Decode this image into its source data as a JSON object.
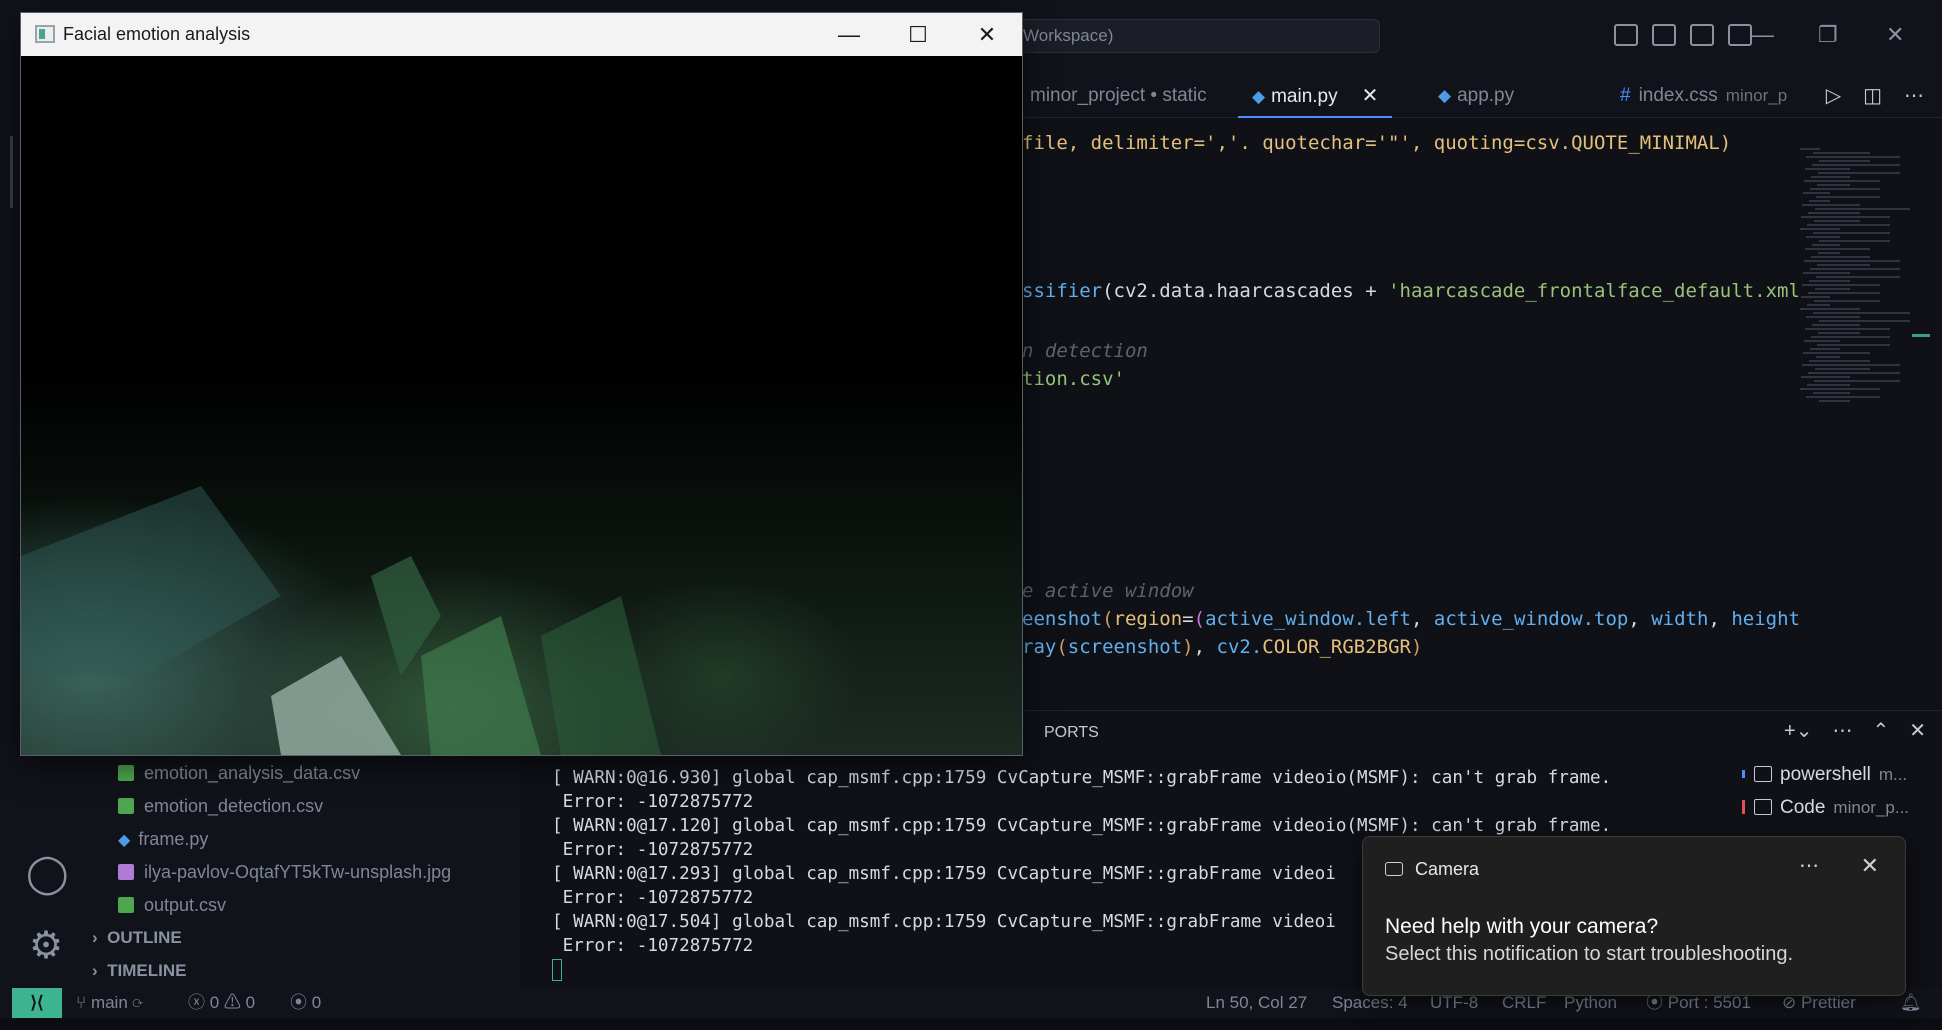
{
  "titlebar": {
    "command_center": "Workspace)"
  },
  "tabs": [
    {
      "label": "minor_project • static",
      "active": false
    },
    {
      "label": "main.py",
      "active": true
    },
    {
      "label": "app.py",
      "active": false
    },
    {
      "label": "index.css",
      "sub": "minor_p",
      "active": false
    }
  ],
  "editor": {
    "lines": [
      {
        "parts": [
          [
            "c-y",
            "file, delimiter=','. quotechar='\"', quoting=csv.QUOTE_MINIMAL)"
          ]
        ]
      },
      {
        "parts": [
          [
            "c-b",
            "ssifier"
          ],
          [
            "c-w",
            "("
          ],
          [
            "c-w",
            "cv2.data.haarcascades + "
          ],
          [
            "c-g",
            "'haarcascade_frontalface_default.xml"
          ]
        ]
      },
      {
        "parts": [
          [
            "c-c",
            "n detection"
          ]
        ]
      },
      {
        "parts": [
          [
            "c-g",
            "tion.csv'"
          ]
        ]
      },
      {
        "parts": [
          [
            "c-c",
            "e active window"
          ]
        ]
      },
      {
        "parts": [
          [
            "c-b",
            "eenshot"
          ],
          [
            "c-o",
            "("
          ],
          [
            "c-y",
            "region"
          ],
          [
            "c-w",
            "="
          ],
          [
            "c-p",
            "("
          ],
          [
            "c-b",
            "active_window.left"
          ],
          [
            "c-w",
            ", "
          ],
          [
            "c-b",
            "active_window.top"
          ],
          [
            "c-w",
            ", "
          ],
          [
            "c-b",
            "width"
          ],
          [
            "c-w",
            ", "
          ],
          [
            "c-b",
            "height"
          ]
        ]
      },
      {
        "parts": [
          [
            "c-b",
            "ray"
          ],
          [
            "c-o",
            "("
          ],
          [
            "c-b",
            "screenshot"
          ],
          [
            "c-o",
            ")"
          ],
          [
            "c-w",
            ", "
          ],
          [
            "c-b",
            "cv2."
          ],
          [
            "c-y",
            "COLOR_RGB2BGR"
          ],
          [
            "c-o",
            ")"
          ]
        ]
      }
    ]
  },
  "explorer": {
    "files": [
      {
        "name": "emotion_analysis_data.csv",
        "type": "csv"
      },
      {
        "name": "emotion_detection.csv",
        "type": "csv"
      },
      {
        "name": "frame.py",
        "type": "py"
      },
      {
        "name": "ilya-pavlov-OqtafYT5kTw-unsplash.jpg",
        "type": "img"
      },
      {
        "name": "output.csv",
        "type": "csv"
      }
    ],
    "outline_label": "OUTLINE",
    "timeline_label": "TIMELINE"
  },
  "panel": {
    "tab_label": "PORTS",
    "terminal_lines": [
      "[ WARN:0@16.930] global cap_msmf.cpp:1759 CvCapture_MSMF::grabFrame videoio(MSMF): can't grab frame.",
      " Error: -1072875772",
      "[ WARN:0@17.120] global cap_msmf.cpp:1759 CvCapture_MSMF::grabFrame videoio(MSMF): can't grab frame.",
      " Error: -1072875772",
      "[ WARN:0@17.293] global cap_msmf.cpp:1759 CvCapture_MSMF::grabFrame videoi",
      " Error: -1072875772",
      "[ WARN:0@17.504] global cap_msmf.cpp:1759 CvCapture_MSMF::grabFrame videoi",
      " Error: -1072875772"
    ],
    "terminals": [
      {
        "name": "powershell",
        "sub": "m..."
      },
      {
        "name": "Code",
        "sub": "minor_p..."
      }
    ]
  },
  "statusbar": {
    "branch": "main",
    "errors": "0",
    "warnings": "0",
    "ports": "0",
    "position": "Ln 50, Col 27",
    "spaces": "Spaces: 4",
    "encoding": "UTF-8",
    "eol": "CRLF",
    "language": "Python",
    "port": "Port : 5501",
    "prettier": "Prettier"
  },
  "camera_window": {
    "title": "Facial emotion analysis"
  },
  "toast": {
    "app": "Camera",
    "title": "Need help with your camera?",
    "body": "Select this notification to start troubleshooting."
  },
  "colors": {
    "accent": "#3bb48f",
    "tab_underline": "#4c8dff",
    "background": "#0f1117"
  }
}
